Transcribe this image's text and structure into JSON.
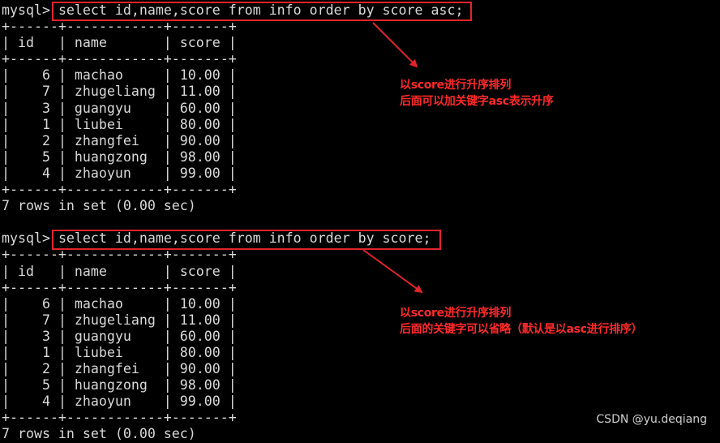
{
  "terminal": {
    "query1": {
      "prompt": "mysql>",
      "command": " select id,name,score from info order by score asc;",
      "border": "+------+------------+-------+",
      "header": "| id   | name       | score |",
      "rows": [
        "|    6 | machao     | 10.00 |",
        "|    7 | zhugeliang | 11.00 |",
        "|    3 | guangyu    | 60.00 |",
        "|    1 | liubei     | 80.00 |",
        "|    2 | zhangfei   | 90.00 |",
        "|    5 | huangzong  | 98.00 |",
        "|    4 | zhaoyun    | 99.00 |"
      ],
      "footer": "7 rows in set (0.00 sec)"
    },
    "query2": {
      "prompt": "mysql>",
      "command": " select id,name,score from info order by score;",
      "border": "+------+------------+-------+",
      "header": "| id   | name       | score |",
      "rows": [
        "|    6 | machao     | 10.00 |",
        "|    7 | zhugeliang | 11.00 |",
        "|    3 | guangyu    | 60.00 |",
        "|    1 | liubei     | 80.00 |",
        "|    2 | zhangfei   | 90.00 |",
        "|    5 | huangzong  | 98.00 |",
        "|    4 | zhaoyun    | 99.00 |"
      ],
      "footer": "7 rows in set (0.00 sec)"
    }
  },
  "annotations": {
    "note1_line1": "以score进行升序排列",
    "note1_line2": "后面可以加关键字asc表示升序",
    "note2_line1": "以score进行升序排列",
    "note2_line2": "后面的关键字可以省略（默认是以asc进行排序）"
  },
  "watermark": "CSDN @yu.deqiang",
  "colors": {
    "background": "#000000",
    "text": "#d9d9d9",
    "highlight": "#e2242b",
    "annotation": "#ff2a2a"
  }
}
